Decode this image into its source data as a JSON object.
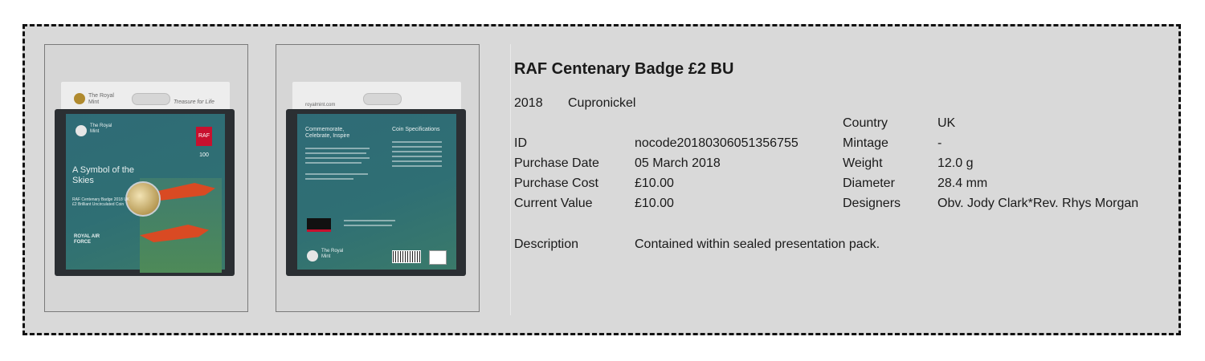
{
  "coin": {
    "title": "RAF Centenary Badge £2 BU",
    "year": "2018",
    "material": "Cupronickel",
    "fields_left": [
      {
        "label": "ID",
        "value": "nocode20180306051356755"
      },
      {
        "label": "Purchase Date",
        "value": "05 March 2018"
      },
      {
        "label": "Purchase Cost",
        "value": "£10.00"
      },
      {
        "label": "Current Value",
        "value": "£10.00"
      }
    ],
    "fields_right": [
      {
        "label": "Country",
        "value": "UK"
      },
      {
        "label": "Mintage",
        "value": "-"
      },
      {
        "label": "Weight",
        "value": "12.0 g"
      },
      {
        "label": "Diameter",
        "value": "28.4 mm"
      },
      {
        "label": "Designers",
        "value": "Obv. Jody Clark*Rev. Rhys Morgan"
      }
    ],
    "description_label": "Description",
    "description": "Contained within sealed presentation pack."
  },
  "front_pack": {
    "brand": "The Royal Mint",
    "slogan": "Treasure for Life",
    "headline": "A Symbol of the Skies",
    "subline": "RAF Centenary Badge 2018 UK £2 Brilliant Uncirculated Coin",
    "raf_mark": "ROYAL AIR FORCE",
    "badge": "RAF 100",
    "accent": "#c8102e"
  },
  "back_pack": {
    "site": "royalmint.com",
    "heading": "Commemorate, Celebrate, Inspire",
    "spec_heading": "Coin Specifications",
    "brand": "The Royal Mint"
  }
}
